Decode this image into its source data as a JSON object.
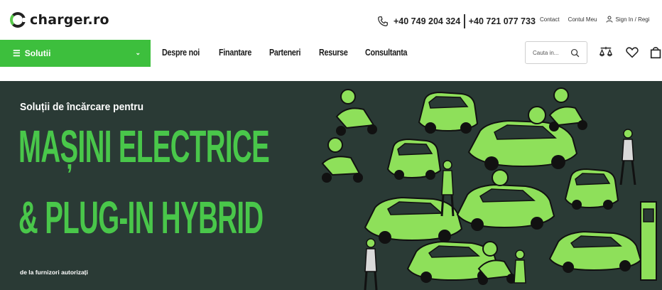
{
  "brand": {
    "name": "charger.ro"
  },
  "header": {
    "phone1": "+40 749 204 324",
    "phone2": "+40 721 077 733",
    "links": [
      "Contact",
      "Contul Meu"
    ],
    "signin": "Sign In / Regi"
  },
  "nav": {
    "solutii": "Solutii",
    "items": [
      "Despre noi",
      "Finantare",
      "Parteneri",
      "Resurse",
      "Consultanta"
    ],
    "search_placeholder": "Cauta in..."
  },
  "hero": {
    "subtitle": "Soluții de încărcare pentru",
    "line1": "MAȘINI ELECTRICE",
    "line2": "& PLUG-IN HYBRID",
    "footnote": "de la furnizori autorizați"
  },
  "colors": {
    "accent": "#3dbf3d",
    "hero_bg": "#2a3a35",
    "hero_text": "#49c74a"
  },
  "icons": [
    "phone-icon",
    "user-icon",
    "search-icon",
    "compare-icon",
    "heart-icon",
    "cart-icon",
    "chevron-down-icon",
    "menu-icon"
  ]
}
